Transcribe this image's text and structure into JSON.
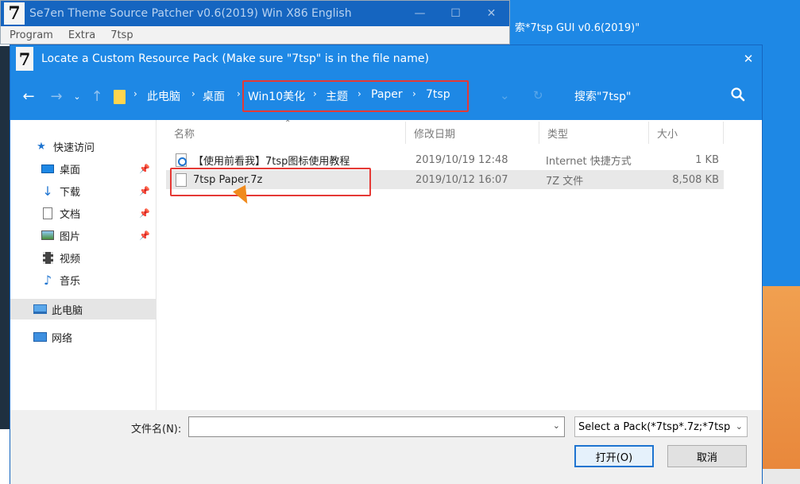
{
  "background": {
    "main_window_title": "*7tsp GUI v0.6(2019)\"",
    "main_window_title_prefix": "索"
  },
  "patcher": {
    "logo": "7",
    "title": "Se7en Theme Source Patcher v0.6(2019) Win X86 English",
    "minimize": "—",
    "maximize": "☐",
    "close": "✕",
    "menu": [
      "Program",
      "Extra",
      "7tsp"
    ]
  },
  "dialog": {
    "logo": "7",
    "title": "Locate a Custom Resource Pack (Make sure \"7tsp\" is in the file name)",
    "close": "✕"
  },
  "navbar": {
    "back": "←",
    "forward": "→",
    "recent": "⌄",
    "up": "↑",
    "breadcrumb": [
      "此电脑",
      "桌面",
      "Win10美化",
      "主题",
      "Paper",
      "7tsp"
    ],
    "separator": "›",
    "dropdown": "⌄",
    "refresh": "↻",
    "search_placeholder": "搜索\"7tsp\""
  },
  "sidebar": {
    "quick_access": "快速访问",
    "items": [
      {
        "label": "桌面",
        "icon": "desktop-icon",
        "pinned": true
      },
      {
        "label": "下载",
        "icon": "download-icon",
        "pinned": true
      },
      {
        "label": "文档",
        "icon": "document-icon",
        "pinned": true
      },
      {
        "label": "图片",
        "icon": "picture-icon",
        "pinned": true
      },
      {
        "label": "视频",
        "icon": "video-icon",
        "pinned": false
      },
      {
        "label": "音乐",
        "icon": "music-icon",
        "pinned": false
      }
    ],
    "this_pc": "此电脑",
    "network": "网络",
    "pin_glyph": "→"
  },
  "file_list": {
    "columns": [
      "名称",
      "修改日期",
      "类型",
      "大小"
    ],
    "rows": [
      {
        "name": "【使用前看我】7tsp图标使用教程",
        "date": "2019/10/19 12:48",
        "type": "Internet 快捷方式",
        "size": "1 KB",
        "icon": "internet-shortcut-icon"
      },
      {
        "name": "7tsp Paper.7z",
        "date": "2019/10/12 16:07",
        "type": "7Z 文件",
        "size": "8,508 KB",
        "icon": "file-icon"
      }
    ]
  },
  "bottom": {
    "filename_label": "文件名(N):",
    "filename_value": "",
    "filter_value": "Select a Pack(*7tsp*.7z;*7tsp",
    "dropdown": "⌄",
    "open_button": "打开(O)",
    "cancel_button": "取消"
  },
  "colors": {
    "accent": "#1e88e5",
    "title_dark": "#1565c0",
    "highlight": "#e53935",
    "cursor": "#f08a1c",
    "folder": "#ffd54f"
  }
}
